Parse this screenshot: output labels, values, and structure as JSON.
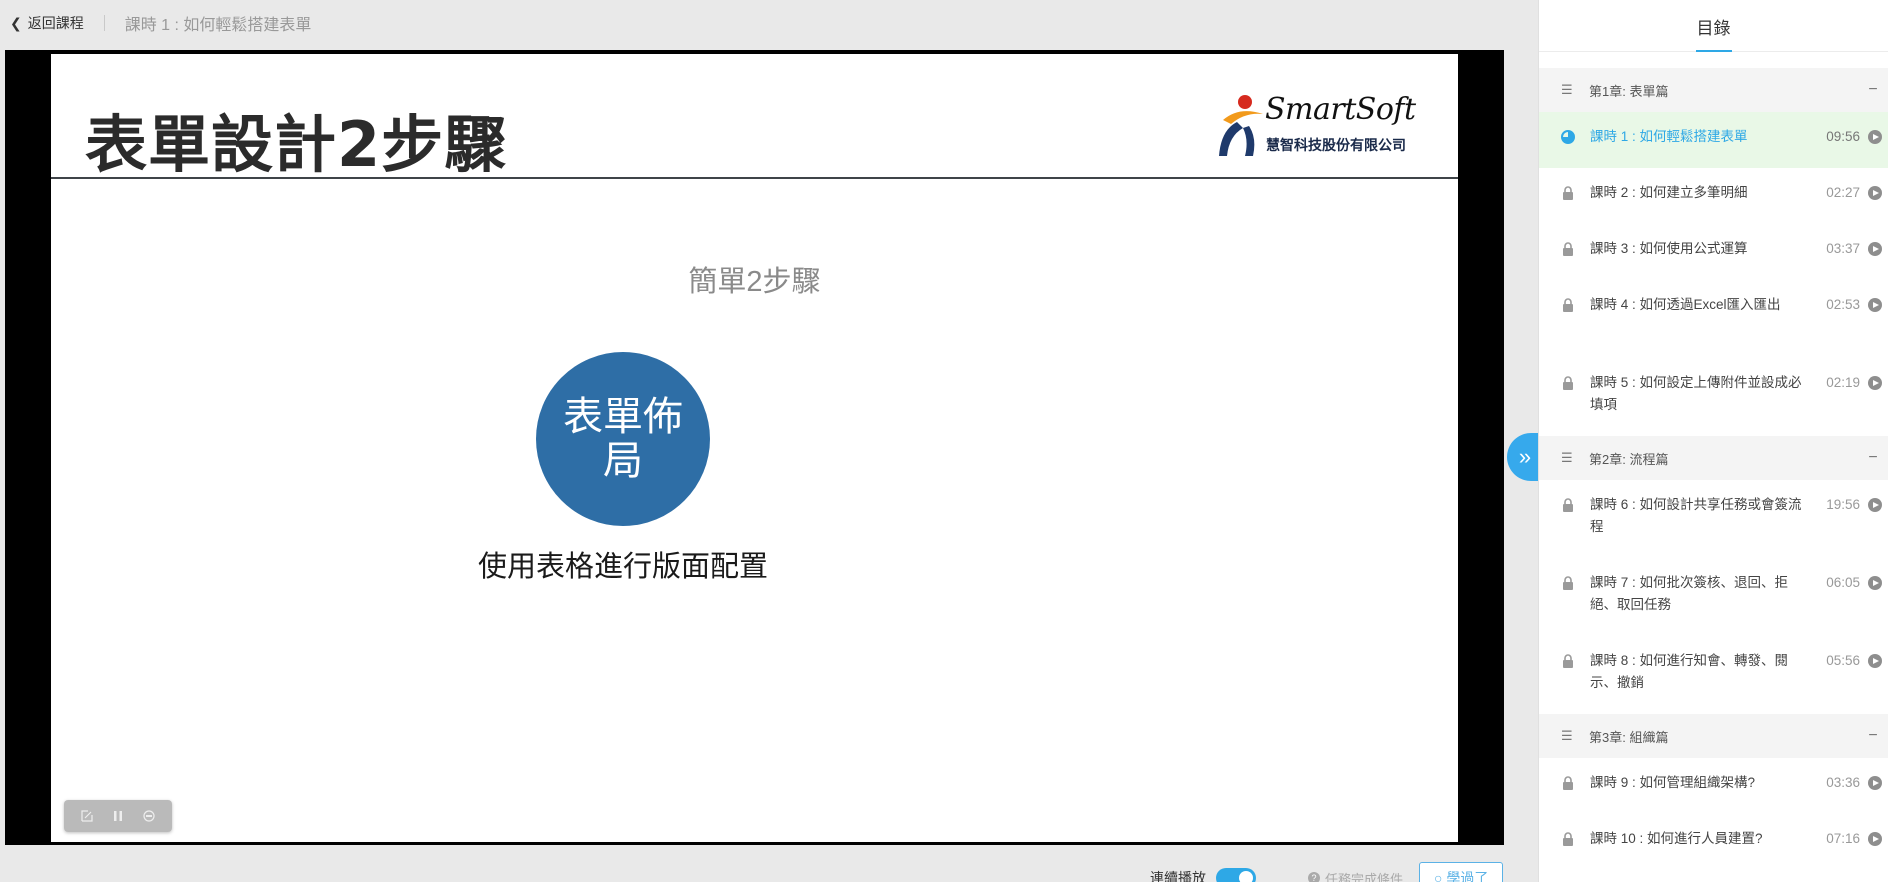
{
  "topbar": {
    "back_label": "返回課程",
    "lesson_title": "課時 1 : 如何輕鬆搭建表單"
  },
  "slide": {
    "title": "表單設計2步驟",
    "logo_text": "SmartSoft",
    "logo_company": "慧智科技股份有限公司",
    "subtitle": "簡單2步驟",
    "circle_text": "表單佈局",
    "caption": "使用表格進行版面配置"
  },
  "player_controls": {
    "icons": [
      "edit-icon",
      "pause-icon",
      "subtitle-icon"
    ]
  },
  "bottom": {
    "autoplay_label": "連續播放",
    "autoplay_on": true,
    "condition_label": "任務完成條件",
    "learned_label": "學過了"
  },
  "sidebar": {
    "tab_label": "目錄",
    "accent_color": "#2ea8e6",
    "chapters": [
      {
        "label": "第1章: 表單篇",
        "lessons": [
          {
            "title": "課時 1 : 如何輕鬆搭建表單",
            "duration": "09:56",
            "state": "active"
          },
          {
            "title": "課時 2 : 如何建立多筆明細",
            "duration": "02:27",
            "state": "locked"
          },
          {
            "title": "課時 3 : 如何使用公式運算",
            "duration": "03:37",
            "state": "locked"
          },
          {
            "title": "課時 4 : 如何透過Excel匯入匯出",
            "duration": "02:53",
            "state": "locked"
          },
          {
            "title": "課時 5 : 如何設定上傳附件並設成必填項",
            "duration": "02:19",
            "state": "locked"
          }
        ]
      },
      {
        "label": "第2章: 流程篇",
        "lessons": [
          {
            "title": "課時 6 : 如何設計共享任務或會簽流程",
            "duration": "19:56",
            "state": "locked"
          },
          {
            "title": "課時 7 : 如何批次簽核、退回、拒絕、取回任務",
            "duration": "06:05",
            "state": "locked"
          },
          {
            "title": "課時 8 : 如何進行知會、轉發、閱示、撤銷",
            "duration": "05:56",
            "state": "locked"
          }
        ]
      },
      {
        "label": "第3章: 組織篇",
        "lessons": [
          {
            "title": "課時 9 : 如何管理組織架構?",
            "duration": "03:36",
            "state": "locked"
          },
          {
            "title": "課時 10 : 如何進行人員建置?",
            "duration": "07:16",
            "state": "locked"
          }
        ]
      }
    ]
  }
}
